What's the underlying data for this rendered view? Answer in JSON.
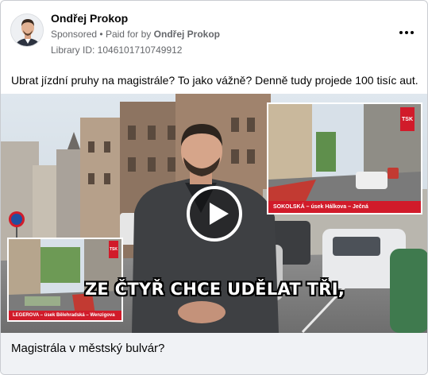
{
  "post": {
    "author": "Ondřej Prokop",
    "sponsored": "Sponsored",
    "paid_for_prefix": "Paid for by",
    "payer": "Ondřej Prokop",
    "library_id": "Library ID: 1046101710749912",
    "caption": "Ubrat jízdní pruhy na magistrále? To jako vážně? Denně tudy projede 100 tisíc aut."
  },
  "icons": {
    "avatar": "avatar",
    "more": "more-options-icon",
    "play": "play-icon"
  },
  "video": {
    "subtitle": "ZE ČTYŘ CHCE UDĚLAT TŘI,",
    "inset_top_label": "SOKOLSKÁ – úsek Hálkova – Ječná",
    "inset_bottom_label": "LEGEROVA – úsek Bělehradská – Wenzigova",
    "logo_text": "TSK"
  },
  "link": {
    "headline": "Magistrála v městský bulvár?"
  },
  "colors": {
    "accent_red": "#d11b2a",
    "headline_bg": "#f0f2f5",
    "meta_gray": "#65676b"
  }
}
